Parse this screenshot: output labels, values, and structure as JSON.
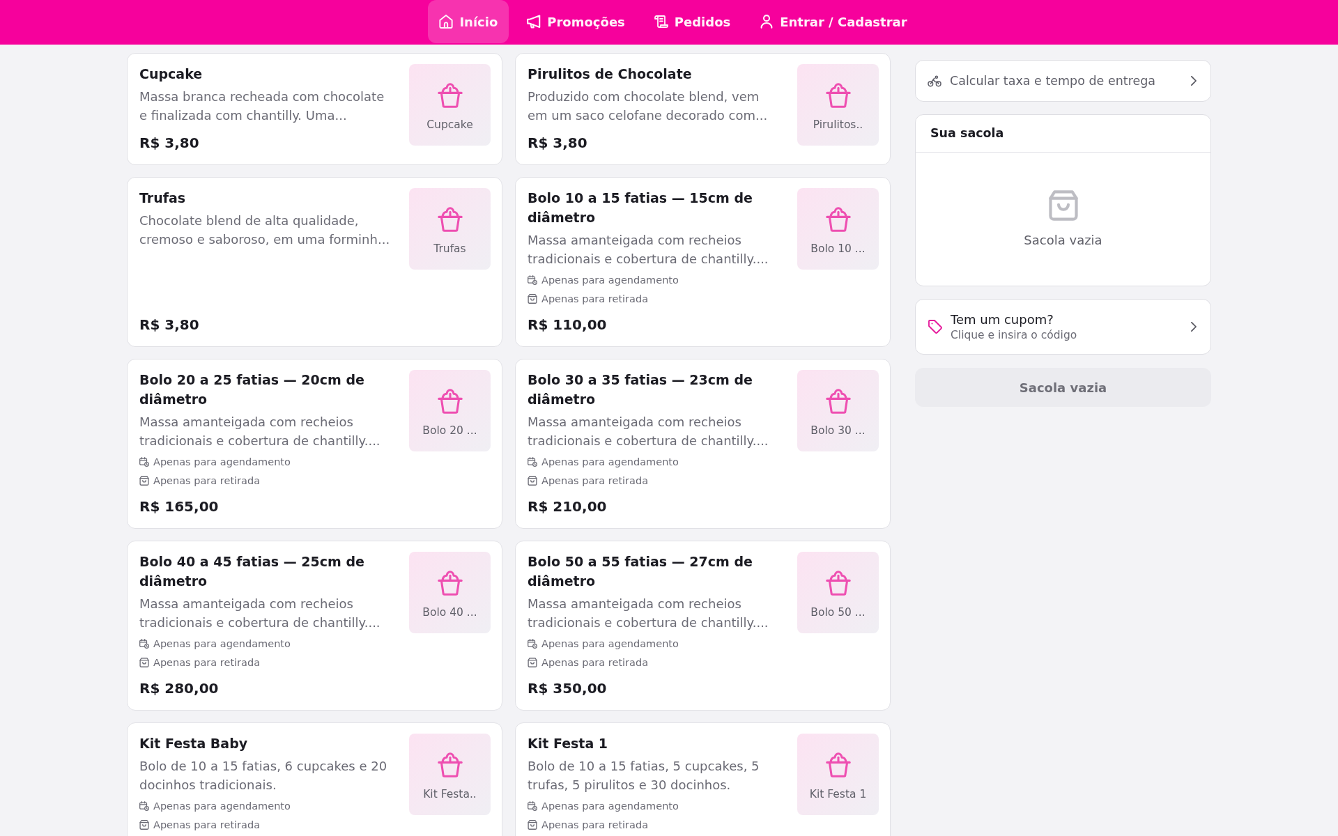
{
  "nav": [
    {
      "kind": "home",
      "label": "Início",
      "selected": true
    },
    {
      "kind": "promotions",
      "label": "Promoções",
      "selected": false
    },
    {
      "kind": "orders",
      "label": "Pedidos",
      "selected": false
    },
    {
      "kind": "account",
      "label": "Entrar / Cadastrar",
      "selected": false
    }
  ],
  "products": [
    {
      "title": "Cupcake",
      "description": "Massa branca recheada com chocolate e finalizada com chantilly. Uma...",
      "thumbnail_label": "Cupcake",
      "price": "R$ 3,80"
    },
    {
      "title": "Pirulitos de Chocolate",
      "description": "Produzido com chocolate blend, vem em um saco celofane decorado com...",
      "thumbnail_label": "Pirulitos..",
      "price": "R$ 3,80"
    },
    {
      "title": "Trufas",
      "description": "Chocolate blend de alta qualidade, cremoso e saboroso, em uma forminh...",
      "thumbnail_label": "Trufas",
      "price": "R$ 3,80"
    },
    {
      "title": "Bolo 10 a 15 fatias — 15cm de diâmetro",
      "description": "Massa amanteigada com recheios tradicionais e cobertura de chantilly....",
      "thumbnail_label": "Bolo 10 ...",
      "tags": [
        {
          "kind": "schedule",
          "label": "Apenas para agendamento"
        },
        {
          "kind": "pickup",
          "label": "Apenas para retirada"
        }
      ],
      "price": "R$ 110,00"
    },
    {
      "title": "Bolo 20 a 25 fatias — 20cm de diâmetro",
      "description": "Massa amanteigada com recheios tradicionais e cobertura de chantilly....",
      "thumbnail_label": "Bolo 20 ...",
      "tags": [
        {
          "kind": "schedule",
          "label": "Apenas para agendamento"
        },
        {
          "kind": "pickup",
          "label": "Apenas para retirada"
        }
      ],
      "price": "R$ 165,00"
    },
    {
      "title": "Bolo 30 a 35 fatias — 23cm de diâmetro",
      "description": "Massa amanteigada com recheios tradicionais e cobertura de chantilly....",
      "thumbnail_label": "Bolo 30 ...",
      "tags": [
        {
          "kind": "schedule",
          "label": "Apenas para agendamento"
        },
        {
          "kind": "pickup",
          "label": "Apenas para retirada"
        }
      ],
      "price": "R$ 210,00"
    },
    {
      "title": "Bolo 40 a 45 fatias — 25cm de diâmetro",
      "description": "Massa amanteigada com recheios tradicionais e cobertura de chantilly....",
      "thumbnail_label": "Bolo 40 ...",
      "tags": [
        {
          "kind": "schedule",
          "label": "Apenas para agendamento"
        },
        {
          "kind": "pickup",
          "label": "Apenas para retirada"
        }
      ],
      "price": "R$ 280,00"
    },
    {
      "title": "Bolo 50 a 55 fatias — 27cm de diâmetro",
      "description": "Massa amanteigada com recheios tradicionais e cobertura de chantilly....",
      "thumbnail_label": "Bolo 50 ...",
      "tags": [
        {
          "kind": "schedule",
          "label": "Apenas para agendamento"
        },
        {
          "kind": "pickup",
          "label": "Apenas para retirada"
        }
      ],
      "price": "R$ 350,00"
    },
    {
      "title": "Kit Festa Baby",
      "description": "Bolo de 10 a 15 fatias, 6 cupcakes e 20 docinhos tradicionais.",
      "thumbnail_label": "Kit Festa..",
      "tags": [
        {
          "kind": "schedule",
          "label": "Apenas para agendamento"
        },
        {
          "kind": "pickup",
          "label": "Apenas para retirada"
        }
      ]
    },
    {
      "title": "Kit Festa 1",
      "description": "Bolo de 10 a 15 fatias, 5 cupcakes, 5 trufas, 5 pirulitos e 30 docinhos.",
      "thumbnail_label": "Kit Festa 1",
      "tags": [
        {
          "kind": "schedule",
          "label": "Apenas para agendamento"
        },
        {
          "kind": "pickup",
          "label": "Apenas para retirada"
        }
      ]
    }
  ],
  "delivery": {
    "label": "Calcular taxa e tempo de entrega"
  },
  "bag": {
    "title": "Sua sacola",
    "empty_message": "Sacola vazia"
  },
  "coupon": {
    "title": "Tem um cupom?",
    "subtitle": "Clique e insira o código"
  },
  "checkout_button": {
    "label": "Sacola vazia",
    "disabled": true
  }
}
